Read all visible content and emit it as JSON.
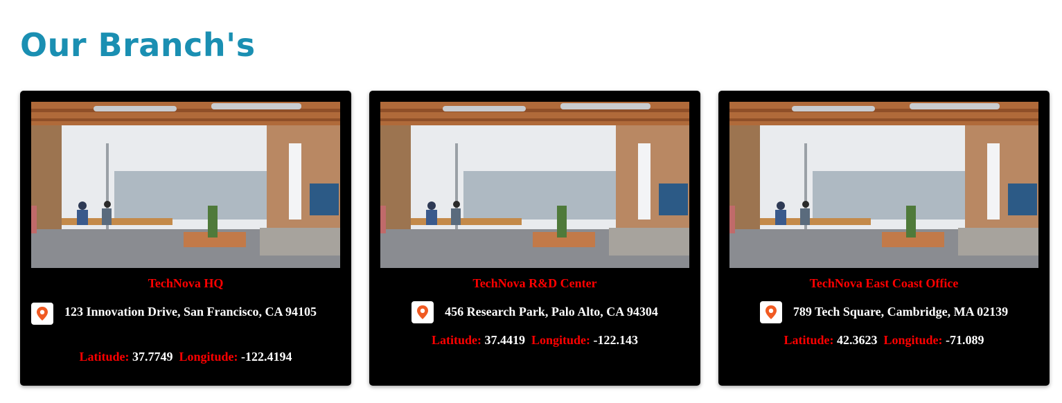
{
  "page": {
    "title": "Our Branch's"
  },
  "branches": [
    {
      "name": "TechNova HQ",
      "address": "123 Innovation Drive, San Francisco, CA 94105",
      "latitude_label": "Latitude:",
      "latitude": "37.7749",
      "longitude_label": "Longitude:",
      "longitude": "-122.4194"
    },
    {
      "name": "TechNova R&D Center",
      "address": "456 Research Park, Palo Alto, CA 94304",
      "latitude_label": "Latitude:",
      "latitude": "37.4419",
      "longitude_label": "Longitude:",
      "longitude": "-122.143"
    },
    {
      "name": "TechNova East Coast Office",
      "address": "789 Tech Square, Cambridge, MA 02139",
      "latitude_label": "Latitude:",
      "latitude": "42.3623",
      "longitude_label": "Longitude:",
      "longitude": "-71.089"
    }
  ],
  "icons": {
    "location": "map-pin-icon",
    "photo": "office-photo"
  },
  "colors": {
    "title": "#1a8fb2",
    "card_bg": "#000000",
    "branch_name": "#ff0000",
    "label": "#ff0000",
    "value": "#ffffff",
    "pin": "#f05a22"
  }
}
